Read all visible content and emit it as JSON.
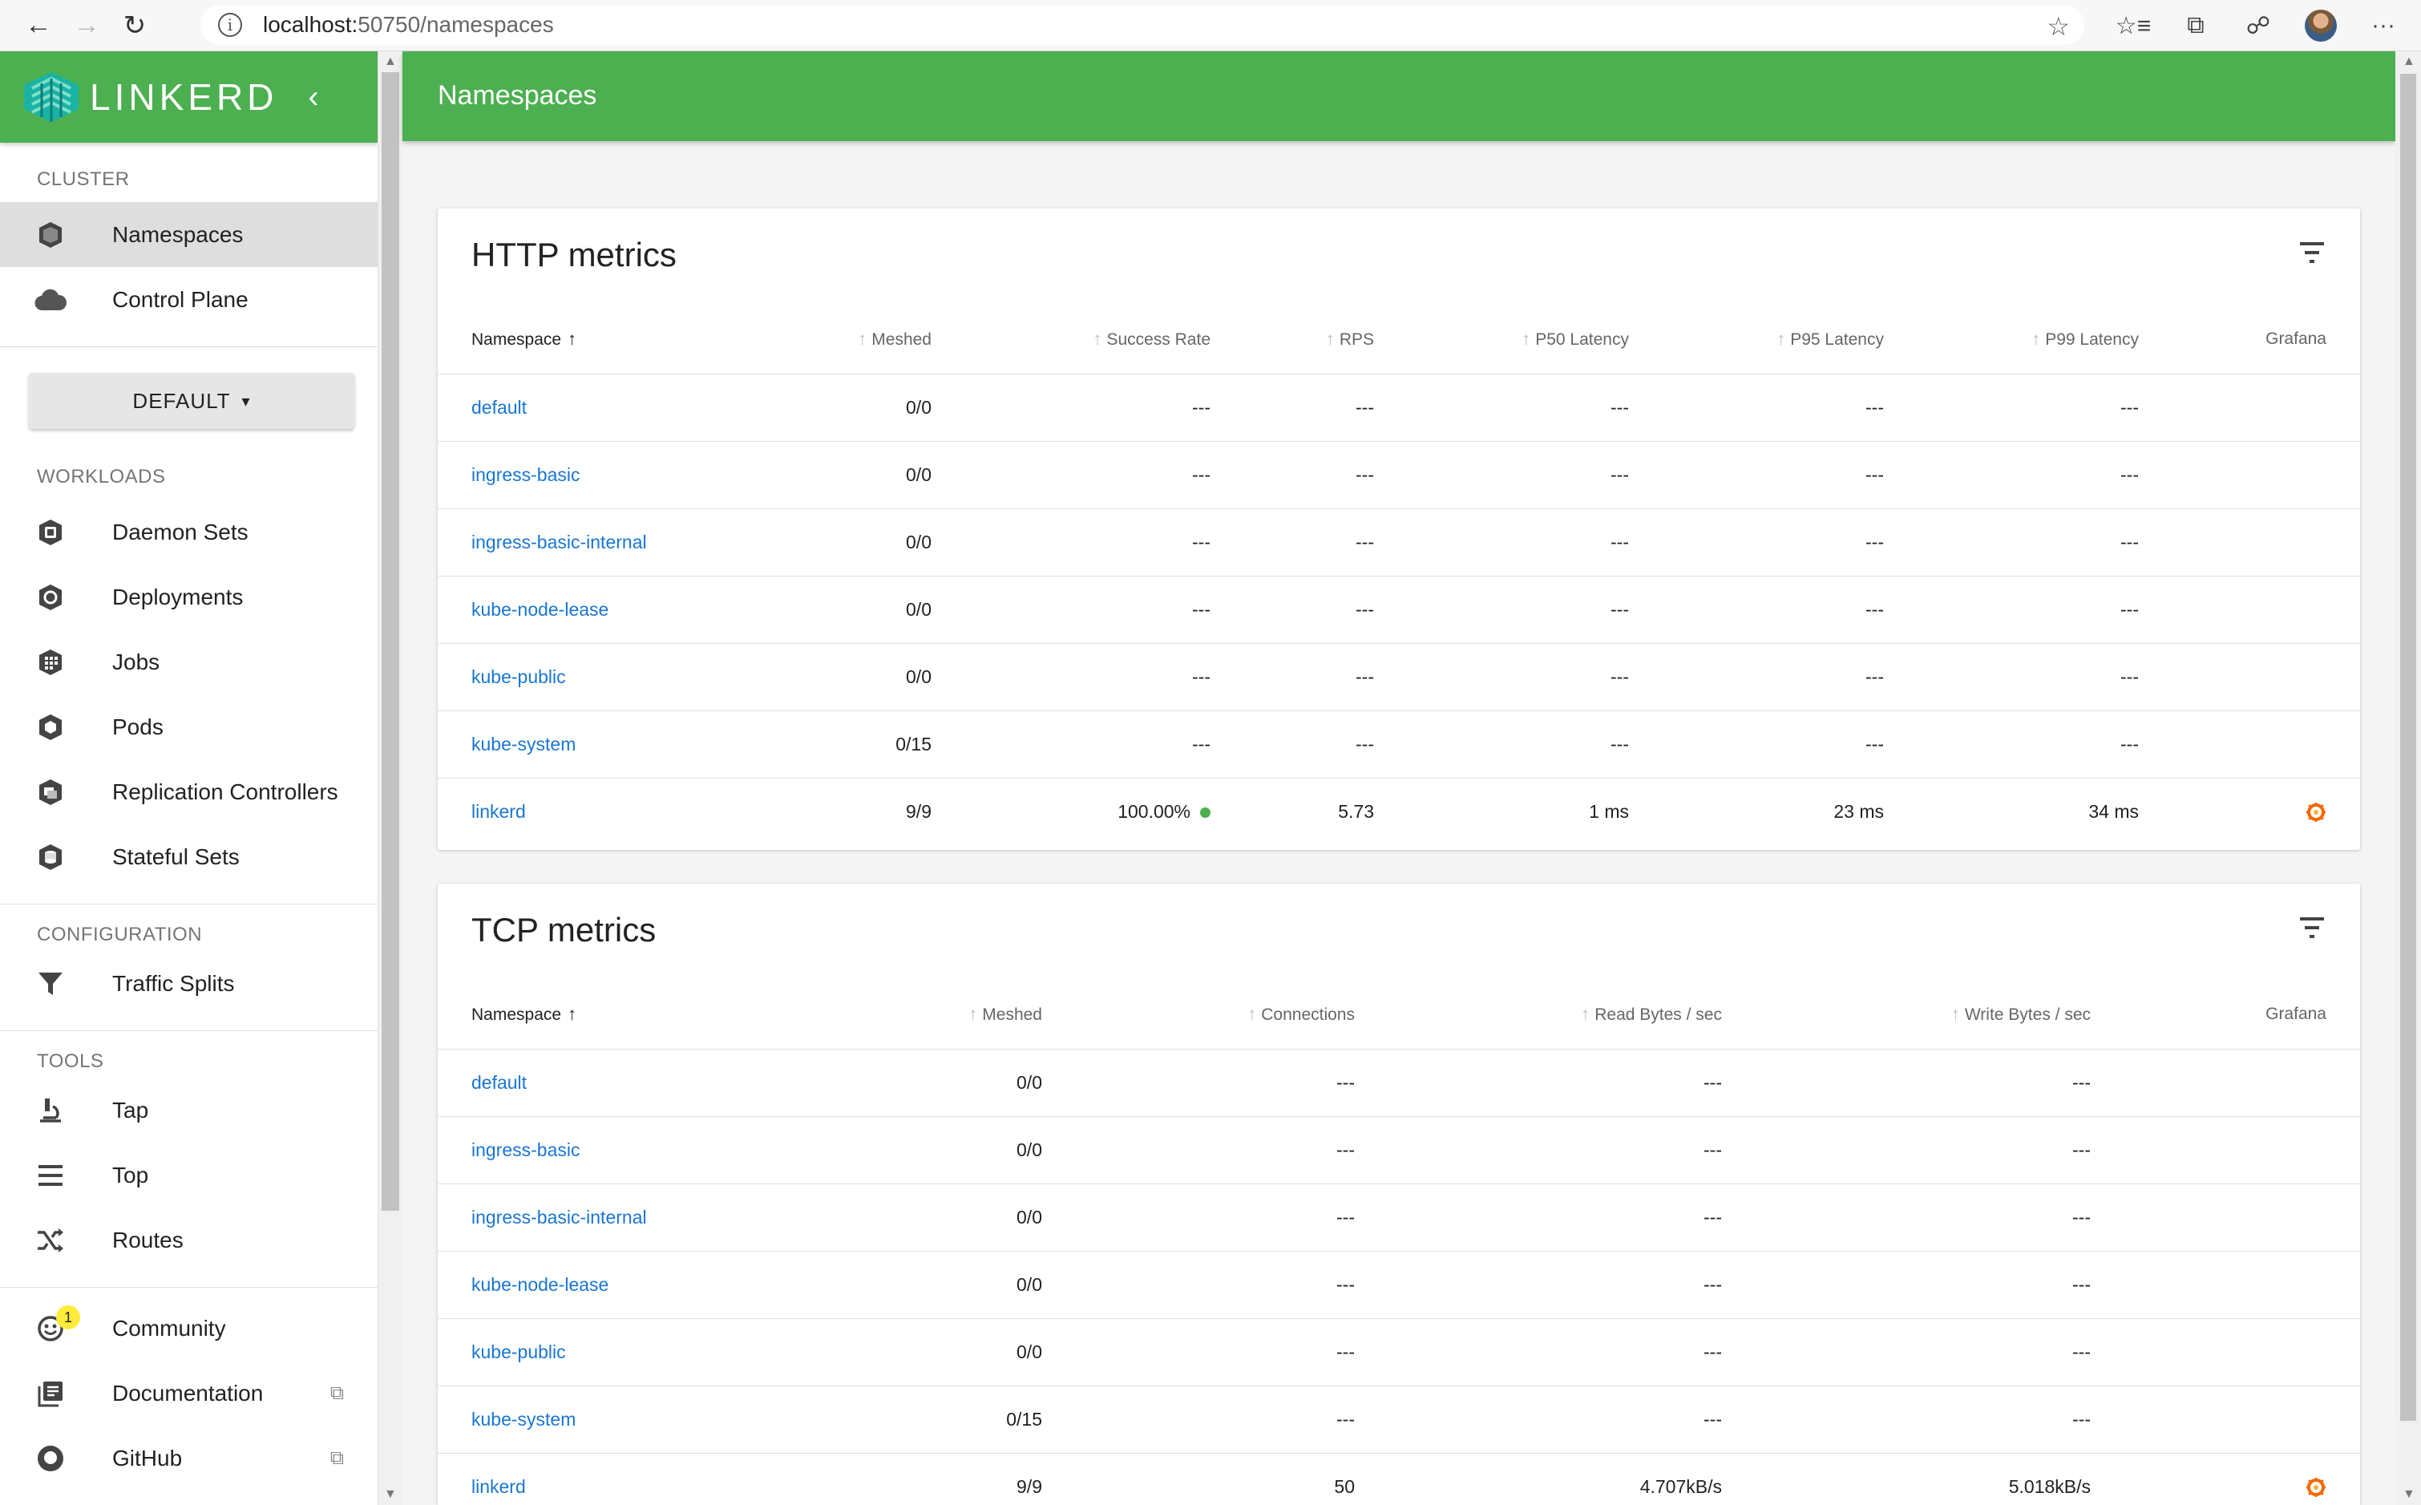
{
  "browser": {
    "url_host": "localhost:",
    "url_rest": "50750/namespaces",
    "back_glyph": "←",
    "forward_glyph": "→",
    "reload_glyph": "↻",
    "info_glyph": "i",
    "star_glyph": "☆",
    "favorites_glyph": "☆≡",
    "collections_glyph": "⧉",
    "feedback_glyph": "☍",
    "more_glyph": "···"
  },
  "sidebar": {
    "brand": "LINKERD",
    "collapse_glyph": "‹",
    "sections": {
      "cluster": "CLUSTER",
      "workloads": "WORKLOADS",
      "configuration": "CONFIGURATION",
      "tools": "TOOLS"
    },
    "cluster_items": [
      "Namespaces",
      "Control Plane"
    ],
    "env_button": "DEFAULT",
    "env_caret": "▾",
    "workload_items": [
      "Daemon Sets",
      "Deployments",
      "Jobs",
      "Pods",
      "Replication Controllers",
      "Stateful Sets"
    ],
    "config_items": [
      "Traffic Splits"
    ],
    "tool_items": [
      "Tap",
      "Top",
      "Routes"
    ],
    "community": "Community",
    "community_badge": "1",
    "documentation": "Documentation",
    "github": "GitHub",
    "external_glyph": "⧉"
  },
  "page": {
    "title": "Namespaces"
  },
  "http": {
    "title": "HTTP metrics",
    "sort_up_glyph": "↑",
    "headers": {
      "namespace": "Namespace",
      "meshed": "Meshed",
      "success": "Success Rate",
      "rps": "RPS",
      "p50": "P50 Latency",
      "p95": "P95 Latency",
      "p99": "P99 Latency",
      "grafana": "Grafana"
    },
    "rows": [
      {
        "ns": "default",
        "meshed": "0/0",
        "success": "---",
        "rps": "---",
        "p50": "---",
        "p95": "---",
        "p99": "---"
      },
      {
        "ns": "ingress-basic",
        "meshed": "0/0",
        "success": "---",
        "rps": "---",
        "p50": "---",
        "p95": "---",
        "p99": "---"
      },
      {
        "ns": "ingress-basic-internal",
        "meshed": "0/0",
        "success": "---",
        "rps": "---",
        "p50": "---",
        "p95": "---",
        "p99": "---"
      },
      {
        "ns": "kube-node-lease",
        "meshed": "0/0",
        "success": "---",
        "rps": "---",
        "p50": "---",
        "p95": "---",
        "p99": "---"
      },
      {
        "ns": "kube-public",
        "meshed": "0/0",
        "success": "---",
        "rps": "---",
        "p50": "---",
        "p95": "---",
        "p99": "---"
      },
      {
        "ns": "kube-system",
        "meshed": "0/15",
        "success": "---",
        "rps": "---",
        "p50": "---",
        "p95": "---",
        "p99": "---"
      },
      {
        "ns": "linkerd",
        "meshed": "9/9",
        "success": "100.00%",
        "rps": "5.73",
        "p50": "1 ms",
        "p95": "23 ms",
        "p99": "34 ms"
      }
    ]
  },
  "tcp": {
    "title": "TCP metrics",
    "sort_up_glyph": "↑",
    "headers": {
      "namespace": "Namespace",
      "meshed": "Meshed",
      "connections": "Connections",
      "read": "Read Bytes / sec",
      "write": "Write Bytes / sec",
      "grafana": "Grafana"
    },
    "rows": [
      {
        "ns": "default",
        "meshed": "0/0",
        "connections": "---",
        "read": "---",
        "write": "---"
      },
      {
        "ns": "ingress-basic",
        "meshed": "0/0",
        "connections": "---",
        "read": "---",
        "write": "---"
      },
      {
        "ns": "ingress-basic-internal",
        "meshed": "0/0",
        "connections": "---",
        "read": "---",
        "write": "---"
      },
      {
        "ns": "kube-node-lease",
        "meshed": "0/0",
        "connections": "---",
        "read": "---",
        "write": "---"
      },
      {
        "ns": "kube-public",
        "meshed": "0/0",
        "connections": "---",
        "read": "---",
        "write": "---"
      },
      {
        "ns": "kube-system",
        "meshed": "0/15",
        "connections": "---",
        "read": "---",
        "write": "---"
      },
      {
        "ns": "linkerd",
        "meshed": "9/9",
        "connections": "50",
        "read": "4.707kB/s",
        "write": "5.018kB/s"
      }
    ]
  },
  "colors": {
    "brand_green": "#4caf50",
    "link_blue": "#1976d2",
    "grafana_orange": "#f46800",
    "success_dot": "#4caf50"
  }
}
